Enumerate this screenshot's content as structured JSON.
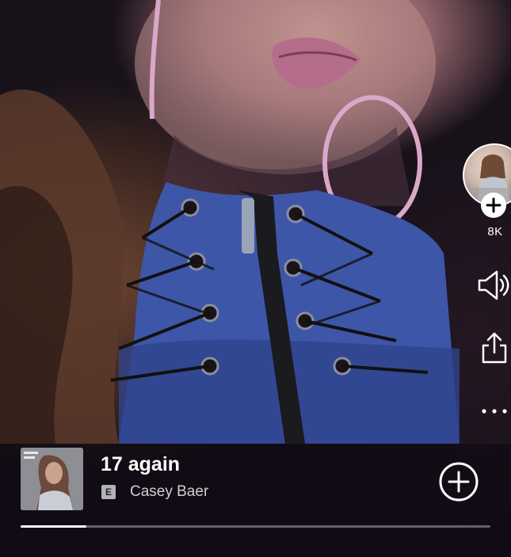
{
  "video": {
    "creator_avatar_icon": "creator-avatar",
    "follower_count": "8K",
    "follow_icon": "plus-icon"
  },
  "actions": {
    "mute_icon": "speaker-muted-icon",
    "share_icon": "share-icon",
    "more_icon": "ellipsis-icon"
  },
  "now_playing": {
    "title": "17 again",
    "explicit_label": "E",
    "artist": "Casey Baer",
    "add_icon": "plus-circle-icon",
    "progress": 0.14
  },
  "colors": {
    "text_primary": "#ffffff",
    "text_secondary": "#d0d0d0",
    "badge_bg": "#b3b3b3",
    "progress_fill": "#ffffff"
  }
}
